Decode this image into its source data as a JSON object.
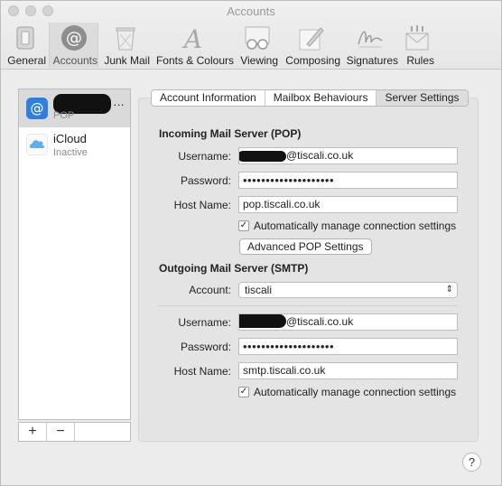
{
  "window": {
    "title": "Accounts"
  },
  "toolbar": {
    "items": [
      {
        "label": "General",
        "icon": "switch-icon"
      },
      {
        "label": "Accounts",
        "icon": "at-sign-icon"
      },
      {
        "label": "Junk Mail",
        "icon": "trash-icon"
      },
      {
        "label": "Fonts & Colours",
        "icon": "font-icon"
      },
      {
        "label": "Viewing",
        "icon": "glasses-icon"
      },
      {
        "label": "Composing",
        "icon": "pencil-icon"
      },
      {
        "label": "Signatures",
        "icon": "signature-icon"
      },
      {
        "label": "Rules",
        "icon": "rules-icon"
      }
    ],
    "active": "Accounts"
  },
  "accounts": [
    {
      "name": "…",
      "sub": "POP",
      "icon": "at-sign-icon",
      "color": "#2f7fe0"
    },
    {
      "name": "iCloud",
      "sub": "Inactive",
      "icon": "cloud-icon",
      "color": "#5ab0f0"
    }
  ],
  "list_footer": {
    "add": "+",
    "remove": "−"
  },
  "tabs": [
    "Account Information",
    "Mailbox Behaviours",
    "Server Settings"
  ],
  "active_tab": "Server Settings",
  "incoming": {
    "title": "Incoming Mail Server (POP)",
    "username_label": "Username:",
    "username": "@tiscali.co.uk",
    "password_label": "Password:",
    "password": "••••••••••••••••••••",
    "host_label": "Host Name:",
    "host": "pop.tiscali.co.uk",
    "auto_manage": "Automatically manage connection settings",
    "auto_checked": "✓",
    "advanced_button": "Advanced POP Settings"
  },
  "outgoing": {
    "title": "Outgoing Mail Server (SMTP)",
    "account_label": "Account:",
    "account": "tiscali",
    "username_label": "Username:",
    "username": "@tiscali.co.uk",
    "password_label": "Password:",
    "password": "••••••••••••••••••••",
    "host_label": "Host Name:",
    "host": "smtp.tiscali.co.uk",
    "auto_manage": "Automatically manage connection settings",
    "auto_checked": "✓"
  },
  "help": "?"
}
